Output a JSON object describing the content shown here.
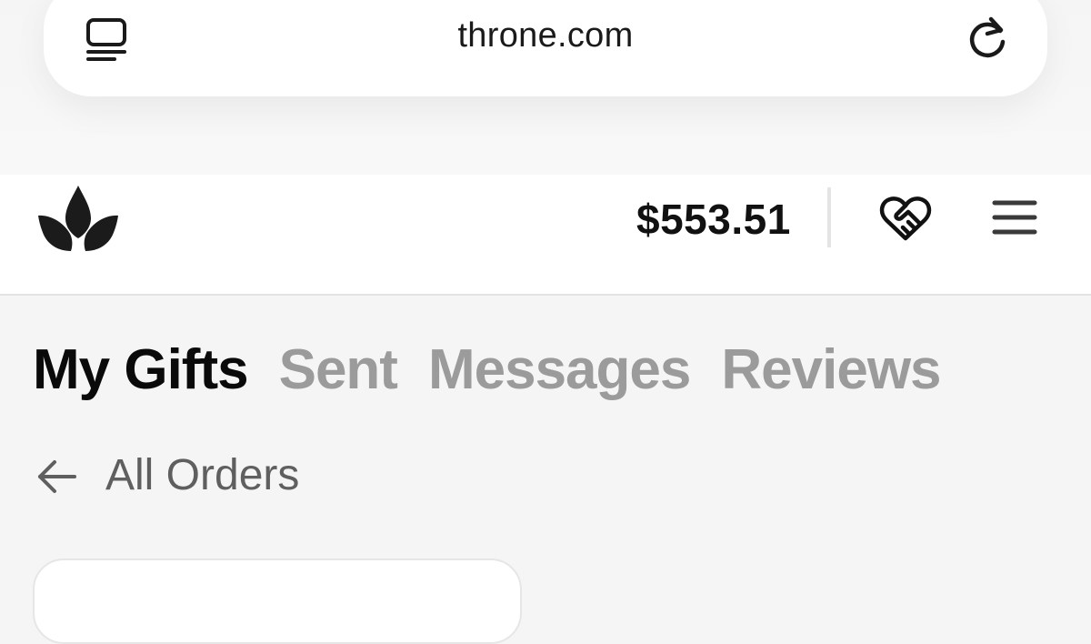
{
  "browser": {
    "url": "throne.com",
    "tabs_icon": "tab-overview-icon",
    "reload_icon": "reload-icon"
  },
  "header": {
    "logo": "throne-crown-logo",
    "balance": "$553.51",
    "wishlist_icon": "heart-handshake-icon",
    "menu_icon": "hamburger-menu-icon"
  },
  "tabs": [
    {
      "label": "My Gifts",
      "active": true
    },
    {
      "label": "Sent",
      "active": false
    },
    {
      "label": "Messages",
      "active": false
    },
    {
      "label": "Reviews",
      "active": false
    }
  ],
  "back_link": {
    "label": "All Orders",
    "icon": "arrow-left-icon"
  },
  "colors": {
    "background": "#f5f5f5",
    "surface": "#ffffff",
    "text_primary": "#111111",
    "text_muted": "#9b9b9b",
    "text_secondary": "#5f5f5f"
  }
}
